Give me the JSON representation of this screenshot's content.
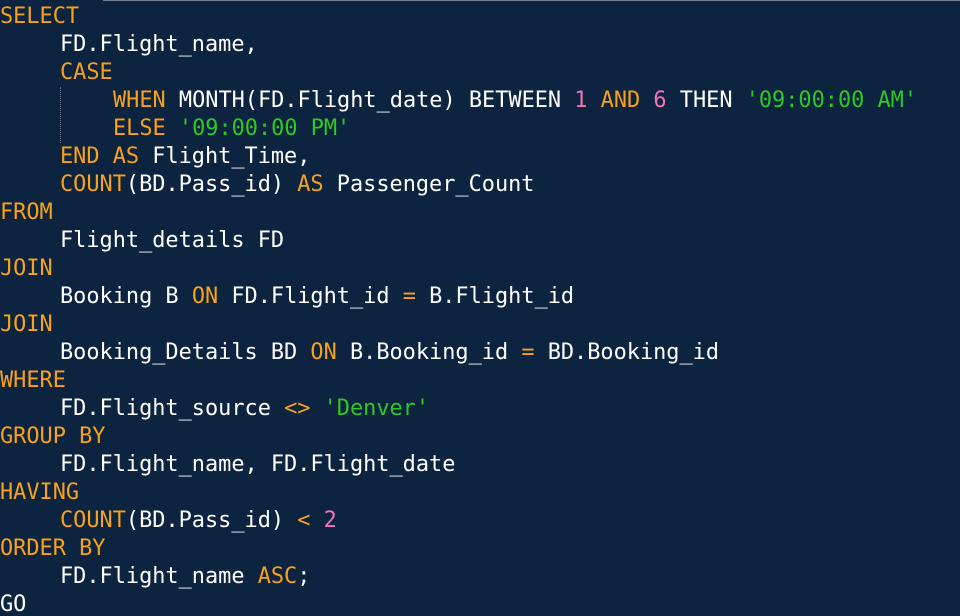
{
  "colors": {
    "background": "#0d2440",
    "keyword": "#f8a21b",
    "identifier": "#ffffff",
    "number": "#f472b6",
    "string": "#2ec825"
  },
  "code": {
    "l1": {
      "kw": "SELECT"
    },
    "l2": {
      "id": "FD.Flight_name,"
    },
    "l3": {
      "kw": "CASE"
    },
    "l4": {
      "when": "WHEN",
      "fn": "MONTH(FD.Flight_date) BETWEEN",
      "n1": "1",
      "and": "AND",
      "n2": "6",
      "then": "THEN",
      "str": "'09:00:00 AM'"
    },
    "l5": {
      "else": "ELSE",
      "str": "'09:00:00 PM'"
    },
    "l6": {
      "end_as": "END AS",
      "id": "Flight_Time,"
    },
    "l7": {
      "count": "COUNT",
      "arg": "(BD.Pass_id)",
      "as": "AS",
      "id": "Passenger_Count"
    },
    "l8": {
      "kw": "FROM"
    },
    "l9": {
      "id": "Flight_details FD"
    },
    "l10": {
      "kw": "JOIN"
    },
    "l11": {
      "id1": "Booking B",
      "on": "ON",
      "id2": "FD.Flight_id",
      "eq": "=",
      "id3": "B.Flight_id"
    },
    "l12": {
      "kw": "JOIN"
    },
    "l13": {
      "id1": "Booking_Details BD",
      "on": "ON",
      "id2": "B.Booking_id",
      "eq": "=",
      "id3": "BD.Booking_id"
    },
    "l14": {
      "kw": "WHERE"
    },
    "l15": {
      "id": "FD.Flight_source",
      "op": "<>",
      "str": "'Denver'"
    },
    "l16": {
      "kw": "GROUP BY"
    },
    "l17": {
      "id": "FD.Flight_name, FD.Flight_date"
    },
    "l18": {
      "kw": "HAVING"
    },
    "l19": {
      "count": "COUNT",
      "arg": "(BD.Pass_id)",
      "op": "<",
      "n": "2"
    },
    "l20": {
      "kw": "ORDER BY"
    },
    "l21": {
      "id": "FD.Flight_name",
      "kw": "ASC",
      "semi": ";"
    },
    "l22": {
      "id": "GO"
    }
  }
}
